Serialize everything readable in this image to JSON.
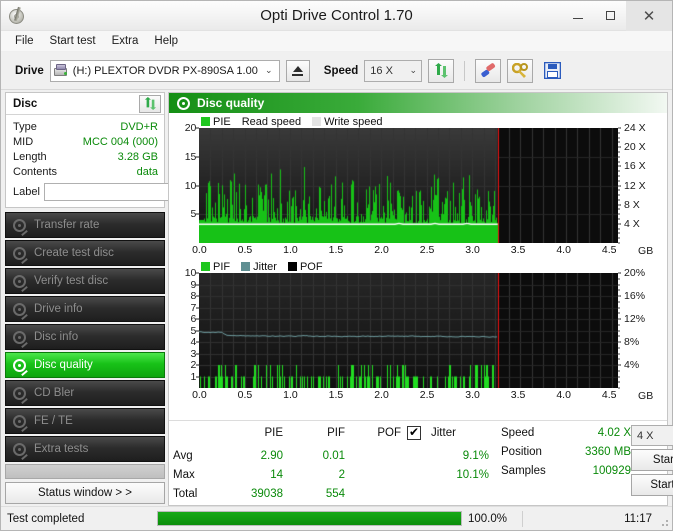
{
  "window": {
    "title": "Opti Drive Control 1.70",
    "icon": "disc-pen-icon",
    "minimize": "–",
    "maximize": "▢",
    "close": "✕"
  },
  "menu": {
    "items": [
      "File",
      "Start test",
      "Extra",
      "Help"
    ]
  },
  "toolbar": {
    "drive_label": "Drive",
    "drive_value": "(H:)  PLEXTOR DVDR  PX-890SA 1.00",
    "drive_arrow": "⌄",
    "eject_icon": "eject-icon",
    "speed_label": "Speed",
    "speed_value": "16 X",
    "speed_arrow": "⌄",
    "refresh_icon": "refresh-icon",
    "erase_icon": "erase-icon",
    "tools_icon": "tools-icon",
    "save_icon": "save-icon"
  },
  "disc_panel": {
    "title": "Disc",
    "refresh_icon": "refresh-icon",
    "rows": [
      {
        "key": "Type",
        "value": "DVD+R"
      },
      {
        "key": "MID",
        "value": "MCC 004 (000)"
      },
      {
        "key": "Length",
        "value": "3.28 GB"
      },
      {
        "key": "Contents",
        "value": "data"
      }
    ],
    "label_key": "Label",
    "label_value": "",
    "label_placeholder": "",
    "label_button_icon": "disc-icon"
  },
  "sidebar": {
    "items": [
      {
        "label": "Transfer rate",
        "active": false
      },
      {
        "label": "Create test disc",
        "active": false
      },
      {
        "label": "Verify test disc",
        "active": false
      },
      {
        "label": "Drive info",
        "active": false
      },
      {
        "label": "Disc info",
        "active": false
      },
      {
        "label": "Disc quality",
        "active": true
      },
      {
        "label": "CD Bler",
        "active": false
      },
      {
        "label": "FE / TE",
        "active": false
      },
      {
        "label": "Extra tests",
        "active": false
      }
    ],
    "status_window_label": "Status window > >"
  },
  "chart_header": {
    "title": "Disc quality",
    "icon": "disc-quality-icon"
  },
  "chart_data": [
    {
      "type": "bar",
      "id": "pie-chart",
      "title": "",
      "legend": [
        {
          "label": "PIE",
          "color": "#1fc71f"
        },
        {
          "label": "Read speed",
          "color": "#ffffff"
        },
        {
          "label": "Write speed",
          "color": "#e8e8e8"
        }
      ],
      "legend_position": "top-left",
      "xlabel": "GB",
      "x_ticks": [
        "0.0",
        "0.5",
        "1.0",
        "1.5",
        "2.0",
        "2.5",
        "3.0",
        "3.5",
        "4.0",
        "4.5"
      ],
      "xlim": [
        0.0,
        4.7
      ],
      "ylabel_left": "PIE",
      "y_ticks_left": [
        "20",
        "15",
        "10",
        "5"
      ],
      "ylim_left": [
        0,
        20
      ],
      "ylabel_right": "Speed",
      "y_ticks_right": [
        "24 X",
        "20 X",
        "16 X",
        "12 X",
        "8 X",
        "4 X"
      ],
      "ylim_right": [
        0,
        24
      ],
      "grid": true,
      "data_end_gb": 3.28,
      "read_speed_value": 4.02,
      "pie_avg": 2.9,
      "pie_max": 14,
      "pie_baseline": 3.5,
      "pie_typical_peak": 11,
      "series_note": "PIE bars span 0.0-3.28 GB, mean ~2.9, peaks to 14"
    },
    {
      "type": "bar",
      "id": "pif-jitter-chart",
      "title": "",
      "legend": [
        {
          "label": "PIF",
          "color": "#1fc71f"
        },
        {
          "label": "Jitter",
          "color": "#5f8f92"
        },
        {
          "label": "POF",
          "color": "#000000"
        }
      ],
      "legend_position": "top-left",
      "xlabel": "GB",
      "x_ticks": [
        "0.0",
        "0.5",
        "1.0",
        "1.5",
        "2.0",
        "2.5",
        "3.0",
        "3.5",
        "4.0",
        "4.5"
      ],
      "xlim": [
        0.0,
        4.7
      ],
      "ylabel_left": "PIF",
      "y_ticks_left": [
        "10",
        "9",
        "8",
        "7",
        "6",
        "5",
        "4",
        "3",
        "2",
        "1"
      ],
      "ylim_left": [
        0,
        10
      ],
      "ylabel_right": "Jitter",
      "y_ticks_right": [
        "20%",
        "16%",
        "12%",
        "8%",
        "4%"
      ],
      "ylim_right": [
        0,
        20
      ],
      "grid": true,
      "data_end_gb": 3.28,
      "pif_avg": 0.01,
      "pif_max": 2,
      "jitter_avg_pct": 9.1,
      "jitter_max_pct": 10.1,
      "series_note": "PIF bars mostly 1-2; jitter line starts ~9.8% falling to ~9.0%"
    }
  ],
  "stats": {
    "col_headers": [
      "PIE",
      "PIF",
      "POF",
      "Jitter"
    ],
    "jitter_checkbox_checked": true,
    "rows": [
      {
        "label": "Avg",
        "pie": "2.90",
        "pif": "0.01",
        "pof": "",
        "jitter": "9.1%"
      },
      {
        "label": "Max",
        "pie": "14",
        "pif": "2",
        "pof": "",
        "jitter": "10.1%"
      },
      {
        "label": "Total",
        "pie": "39038",
        "pif": "554",
        "pof": "",
        "jitter": ""
      }
    ],
    "side": [
      {
        "label": "Speed",
        "value": "4.02 X"
      },
      {
        "label": "Position",
        "value": "3360 MB"
      },
      {
        "label": "Samples",
        "value": "100929"
      }
    ],
    "speed_select": "4 X",
    "speed_select_arrow": "⌄",
    "start_full_label": "Start full",
    "start_part_label": "Start part"
  },
  "statusbar": {
    "text": "Test completed",
    "progress_pct": 100.0,
    "progress_label": "100.0%",
    "time": "11:17"
  },
  "colors": {
    "accent_green": "#0a8a0a",
    "bar_green": "#1fc71f",
    "plot_bg": "#111111",
    "marker_red": "#ee1111",
    "jitter": "#5f8f92"
  }
}
